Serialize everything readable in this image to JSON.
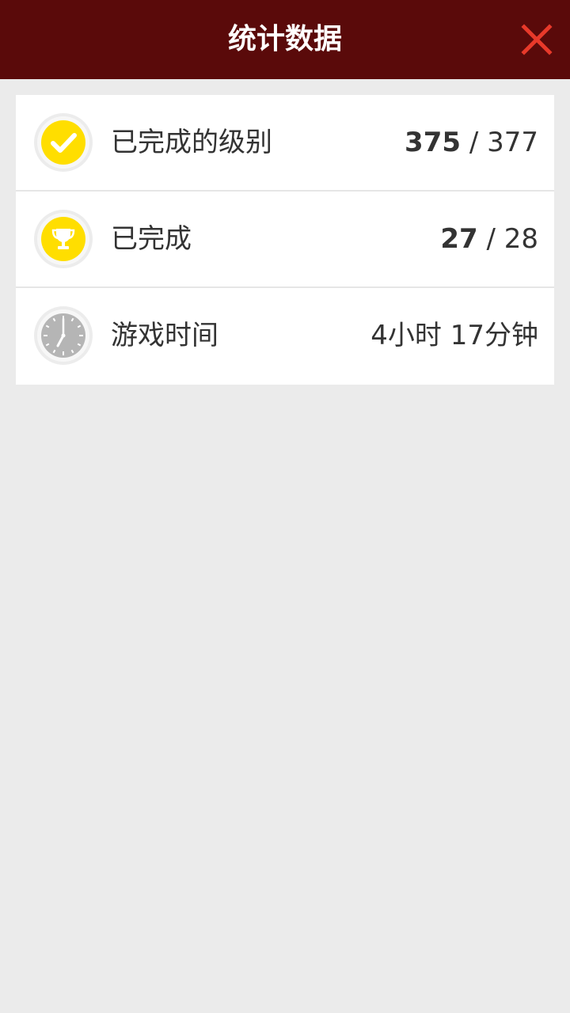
{
  "header": {
    "title": "统计数据",
    "close_icon": "close-icon"
  },
  "colors": {
    "header_bg": "#5a0a0a",
    "close": "#e8392a",
    "accent_yellow": "#ffde00",
    "clock_gray": "#b5b5b5"
  },
  "stats": [
    {
      "icon": "check-icon",
      "label": "已完成的级别",
      "value": "375",
      "separator": " / ",
      "total": "377"
    },
    {
      "icon": "trophy-icon",
      "label": "已完成",
      "value": "27",
      "separator": " / ",
      "total": "28"
    },
    {
      "icon": "clock-icon",
      "label": "游戏时间",
      "value_text": "4小时 17分钟"
    }
  ]
}
